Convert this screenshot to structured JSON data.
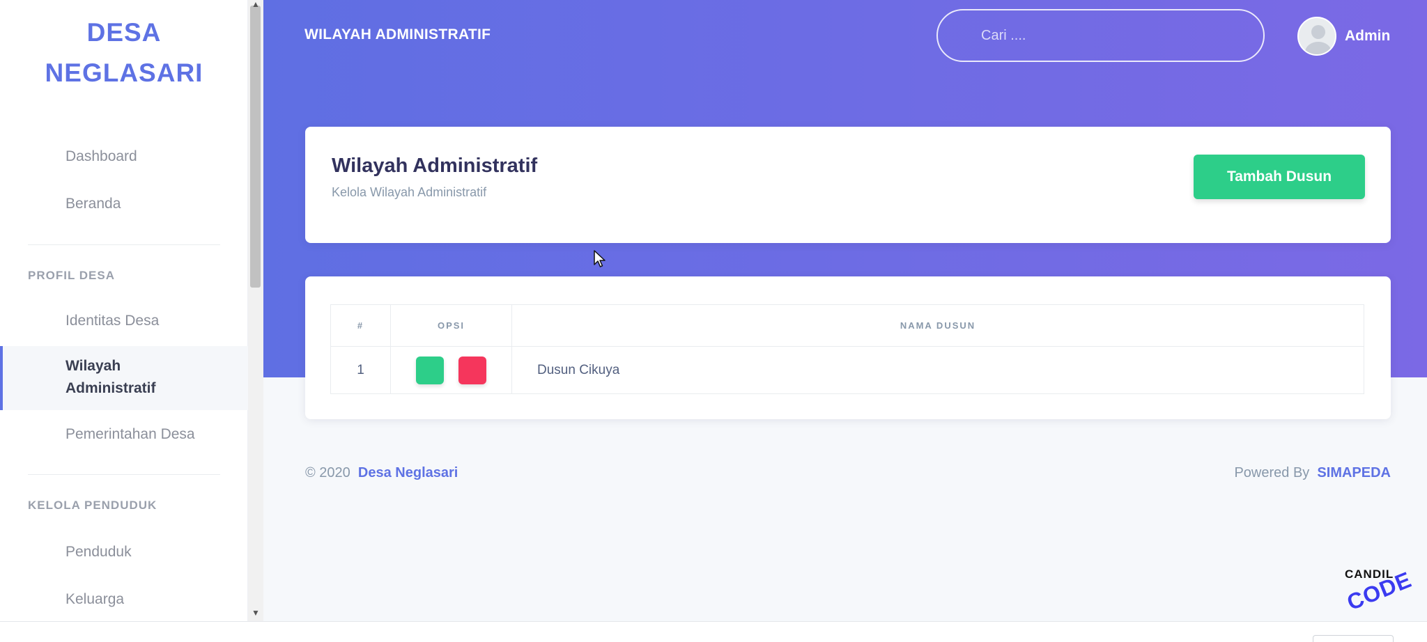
{
  "sidebar": {
    "brand_line1": "DESA",
    "brand_line2": "NEGLASARI",
    "items_top": [
      {
        "label": "Dashboard"
      },
      {
        "label": "Beranda"
      }
    ],
    "section_profil": "PROFIL DESA",
    "profil_items": [
      {
        "label": "Identitas Desa"
      },
      {
        "label": "Wilayah Administratif",
        "active": true
      },
      {
        "label": "Pemerintahan Desa"
      }
    ],
    "section_penduduk": "KELOLA PENDUDUK",
    "penduduk_items": [
      {
        "label": "Penduduk"
      },
      {
        "label": "Keluarga"
      }
    ]
  },
  "header": {
    "page_heading": "WILAYAH ADMINISTRATIF",
    "search_placeholder": "Cari ....",
    "user_name": "Admin"
  },
  "title_card": {
    "title": "Wilayah Administratif",
    "subtitle": "Kelola Wilayah Administratif",
    "add_button": "Tambah Dusun"
  },
  "table": {
    "headers": [
      "#",
      "OPSI",
      "NAMA DUSUN"
    ],
    "rows": [
      {
        "num": "1",
        "name": "Dusun Cikuya"
      }
    ]
  },
  "footer": {
    "copyright": "© 2020",
    "copyright_link": "Desa Neglasari",
    "powered": "Powered By",
    "powered_link": "SIMAPEDA"
  },
  "watermark": {
    "line1": "CANDIL",
    "line2": "CODE"
  },
  "colors": {
    "primary": "#5e72e4",
    "success": "#2dce89",
    "danger": "#f5365c",
    "gradient_start": "#5f6fe3",
    "gradient_end": "#7b69e5"
  }
}
